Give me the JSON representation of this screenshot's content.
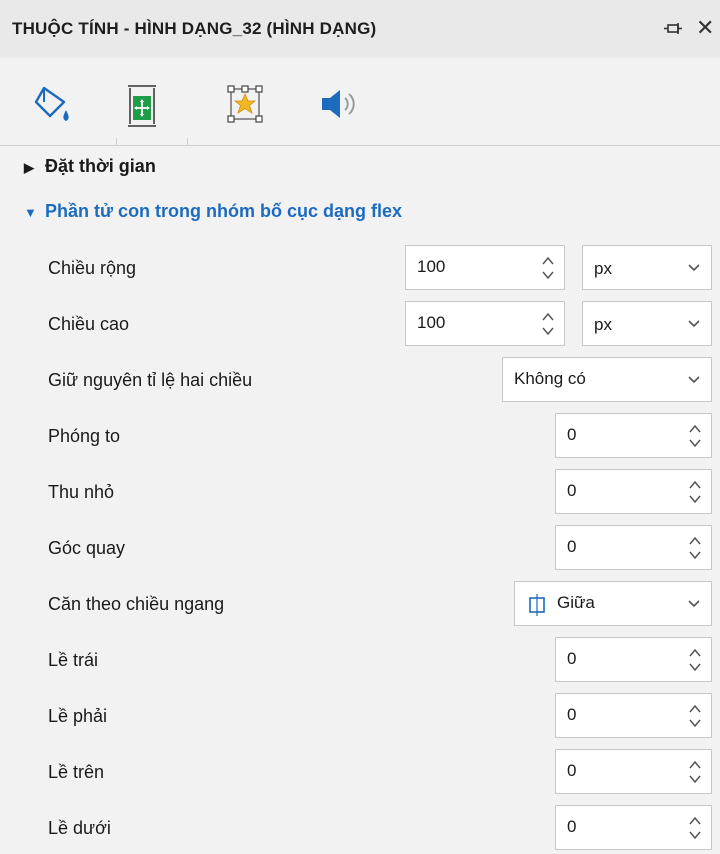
{
  "panel": {
    "title": "THUỘC TÍNH - HÌNH DẠNG_32 (HÌNH DẠNG)",
    "close_glyph": "✕"
  },
  "toolbar": {
    "tabs": [
      {
        "icon": "paint-bucket-icon"
      },
      {
        "icon": "layout-position-icon",
        "active": true
      },
      {
        "icon": "star-effect-icon"
      },
      {
        "icon": "speaker-sound-icon"
      }
    ]
  },
  "sections": {
    "timing": {
      "label": "Đặt thời gian",
      "state": "collapsed"
    },
    "flex": {
      "label": "Phần tử con trong nhóm bố cục dạng flex",
      "state": "expanded"
    }
  },
  "props": {
    "width": {
      "label": "Chiều rộng",
      "value": "100",
      "unit": "px"
    },
    "height": {
      "label": "Chiều cao",
      "value": "100",
      "unit": "px"
    },
    "aspect": {
      "label": "Giữ nguyên tỉ lệ hai chiều",
      "value": "Không có"
    },
    "grow": {
      "label": "Phóng to",
      "value": "0"
    },
    "shrink": {
      "label": "Thu nhỏ",
      "value": "0"
    },
    "rotation": {
      "label": "Góc quay",
      "value": "0"
    },
    "halign": {
      "label": "Căn theo chiều ngang",
      "value": "Giữa"
    },
    "margin_left": {
      "label": "Lề trái",
      "value": "0"
    },
    "margin_right": {
      "label": "Lề phải",
      "value": "0"
    },
    "margin_top": {
      "label": "Lề trên",
      "value": "0"
    },
    "margin_bottom": {
      "label": "Lề dưới",
      "value": "0"
    }
  },
  "colors": {
    "accent": "#1c6bbf",
    "green": "#1e9e48",
    "gold": "#f2b824"
  }
}
